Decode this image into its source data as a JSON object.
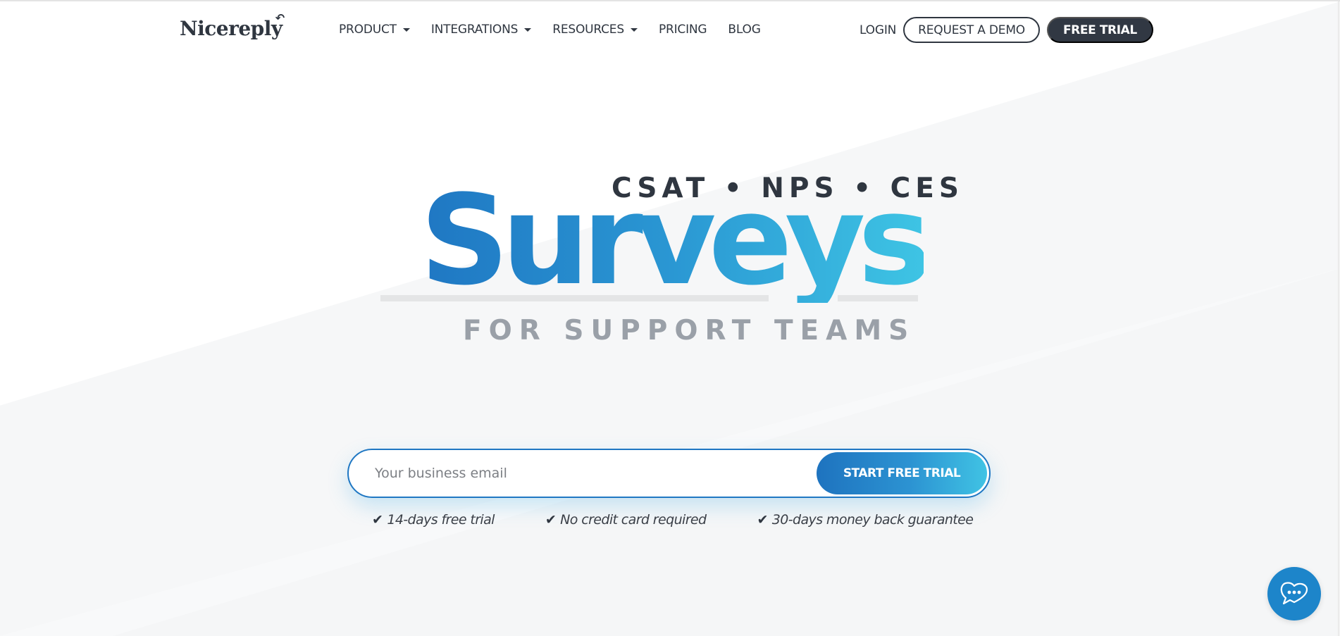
{
  "header": {
    "logo_text": "Nicereply",
    "nav": [
      {
        "label": "PRODUCT",
        "has_dropdown": true
      },
      {
        "label": "INTEGRATIONS",
        "has_dropdown": true
      },
      {
        "label": "RESOURCES",
        "has_dropdown": true
      },
      {
        "label": "PRICING",
        "has_dropdown": false
      },
      {
        "label": "BLOG",
        "has_dropdown": false
      }
    ],
    "login_label": "LOGIN",
    "demo_label": "REQUEST A DEMO",
    "trial_label": "FREE TRIAL"
  },
  "hero": {
    "metrics": "CSAT • NPS • CES",
    "title": "Surveys",
    "tagline": "FOR SUPPORT TEAMS"
  },
  "signup": {
    "email_placeholder": "Your business email",
    "email_value": "",
    "submit_label": "START FREE TRIAL"
  },
  "benefits": [
    {
      "icon": "check-icon",
      "text": "14-days free trial"
    },
    {
      "icon": "check-icon",
      "text": "No credit card required"
    },
    {
      "icon": "check-icon",
      "text": "30-days money back guarantee"
    }
  ],
  "colors": {
    "brand_dark": "#313843",
    "accent_blue_start": "#1f77c3",
    "accent_blue_end": "#3ec4e4",
    "tagline_gray": "#9aa0a8",
    "chat_blue": "#1d85ca"
  },
  "chat_widget": {
    "icon": "chat-bubble-heart-icon"
  }
}
